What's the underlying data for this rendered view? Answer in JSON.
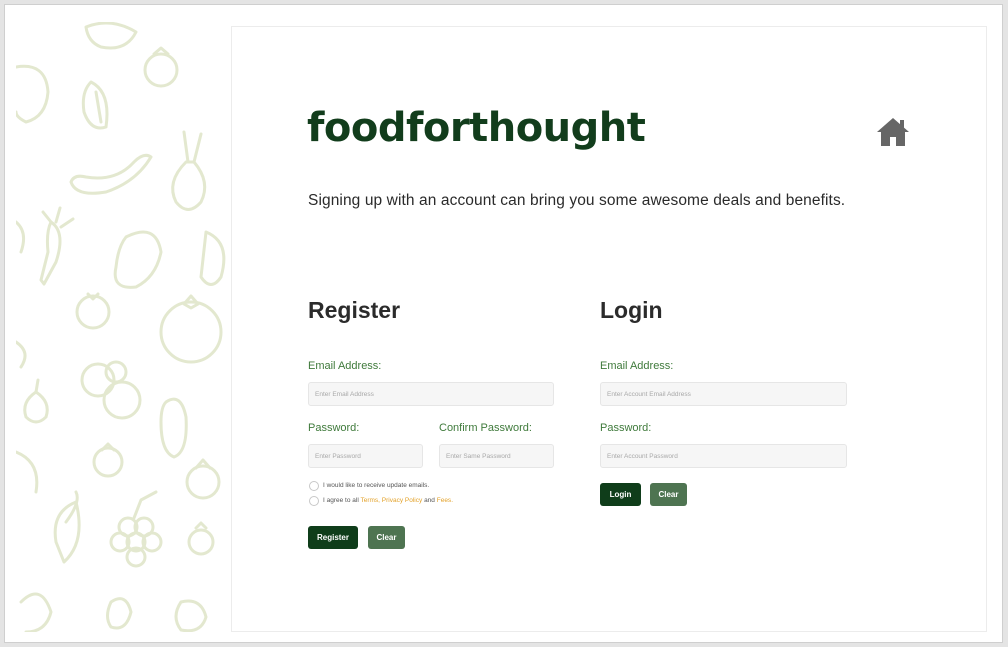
{
  "brand": {
    "name": "foodforthought",
    "color": "#123d1c"
  },
  "header": {
    "home_icon": "home-icon"
  },
  "tagline": "Signing up with an account can bring you some awesome deals and benefits.",
  "register": {
    "title": "Register",
    "email_label": "Email Address:",
    "email_placeholder": "Enter Email Address",
    "password_label": "Password:",
    "password_placeholder": "Enter Password",
    "confirm_label": "Confirm Password:",
    "confirm_placeholder": "Enter Same Password",
    "updates_text": "I would like to receive update emails.",
    "agree_prefix": "I agree to all ",
    "terms": "Terms",
    "sep1": ", ",
    "privacy": "Privacy Policy",
    "sep2": " and ",
    "fees": "Fees",
    "end": ".",
    "register_button": "Register",
    "clear_button": "Clear"
  },
  "login": {
    "title": "Login",
    "email_label": "Email Address:",
    "email_placeholder": "Enter Account Email Address",
    "password_label": "Password:",
    "password_placeholder": "Enter Account Password",
    "login_button": "Login",
    "clear_button": "Clear"
  },
  "colors": {
    "primary": "#0f3d1a",
    "secondary": "#4e7451",
    "label": "#3f7a3b",
    "link": "#e3a22a",
    "pattern": "#e6ead4"
  }
}
